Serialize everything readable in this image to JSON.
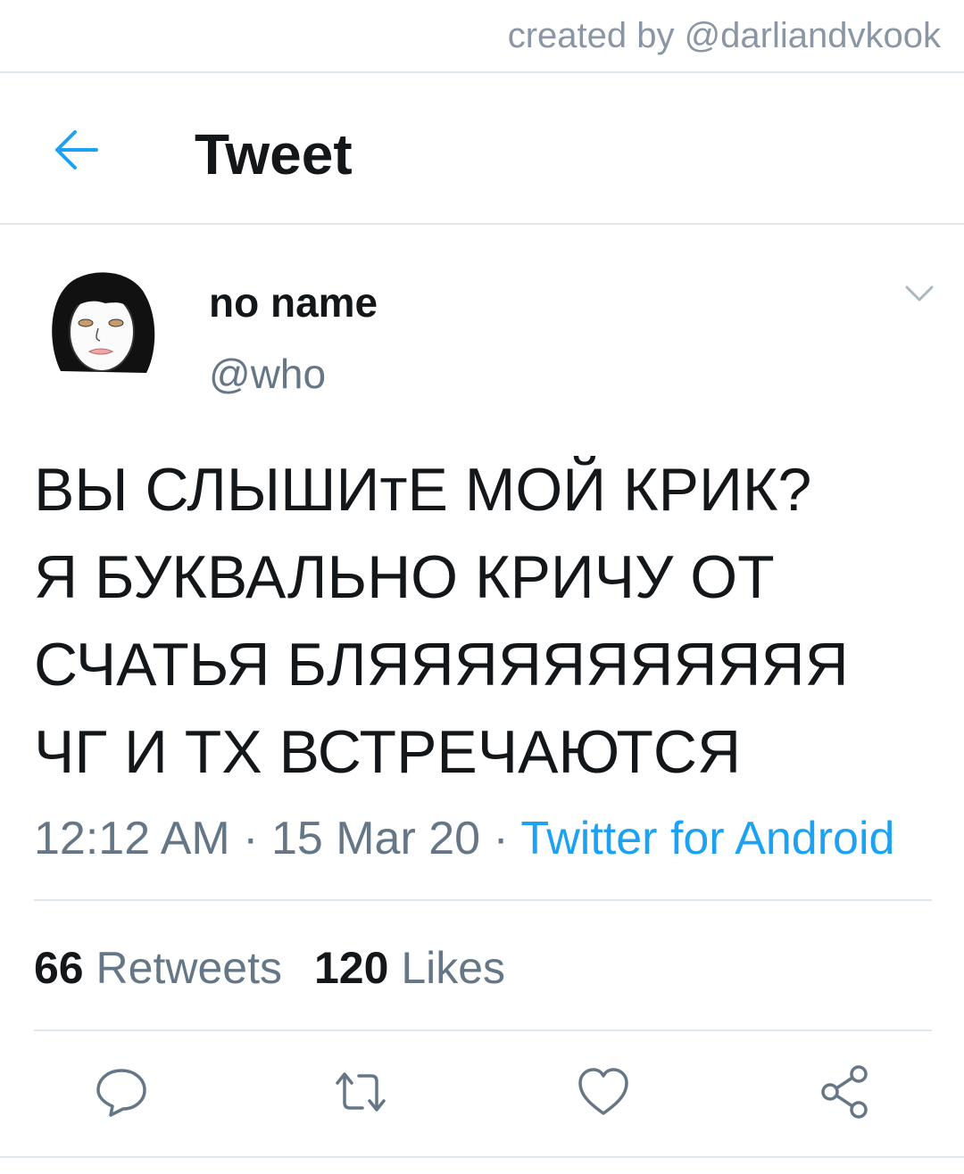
{
  "watermark": "created by @darliandvkook",
  "header": {
    "title": "Tweet",
    "back_icon": "arrow-left-icon"
  },
  "tweet": {
    "author_name": "no name",
    "handle": "@who",
    "text_lines": [
      "ВЫ СЛЫШИтЕ МОЙ КРИК?",
      "Я БУКВАЛЬНО КРИЧУ ОТ",
      "СЧАТЬЯ БЛЯЯЯЯЯЯЯЯЯЯЯ",
      "ЧГ И ТХ ВСТРЕЧАЮТСЯ"
    ],
    "time": "12:12 AM",
    "date": "15 Mar 20",
    "separator": " · ",
    "source": "Twitter for Android"
  },
  "stats": {
    "retweets_count": "66",
    "retweets_label": "Retweets",
    "likes_count": "120",
    "likes_label": "Likes"
  },
  "actions": [
    "reply-icon",
    "retweet-icon",
    "like-icon",
    "share-icon"
  ],
  "colors": {
    "accent": "#1da1f2",
    "secondary": "#657786",
    "divider": "#e1e8ed"
  }
}
